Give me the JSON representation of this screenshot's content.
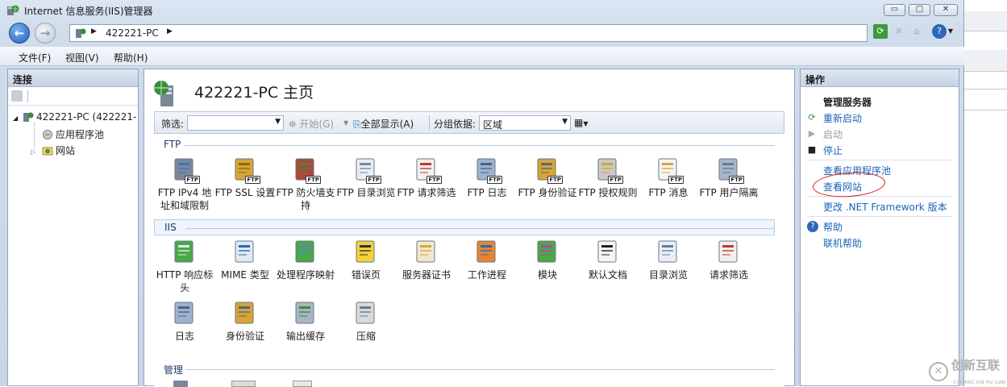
{
  "window": {
    "title": "Internet 信息服务(IIS)管理器",
    "controls": {
      "minimize": "▭",
      "maximize": "□",
      "close": "✕"
    }
  },
  "navbar": {
    "back_icon": "back-arrow-icon",
    "forward_icon": "forward-arrow-icon",
    "address": {
      "crumbs": [
        "422221-PC"
      ]
    },
    "toolbar_icons": [
      "refresh-icon",
      "stop-icon",
      "home-icon",
      "help-icon"
    ]
  },
  "menu": {
    "items": [
      "文件(F)",
      "视图(V)",
      "帮助(H)"
    ]
  },
  "connections": {
    "header": "连接",
    "tree": [
      {
        "label": "422221-PC (422221-",
        "level": 0,
        "expanded": true,
        "icon": "server-icon"
      },
      {
        "label": "应用程序池",
        "level": 1,
        "icon": "app-pool-icon"
      },
      {
        "label": "网站",
        "level": 1,
        "expanded": false,
        "icon": "sites-icon"
      }
    ]
  },
  "main": {
    "title": "422221-PC 主页",
    "filter": {
      "label": "筛选:",
      "value": "",
      "start": "开始(G)",
      "show_all": "全部显示(A)",
      "group_by_label": "分组依据:",
      "group_by_value": "区域"
    },
    "groups": [
      {
        "name": "FTP",
        "items": [
          {
            "label": "FTP IPv4 地址和域限制",
            "icon": "ftp-ip-restrictions-icon"
          },
          {
            "label": "FTP SSL 设置",
            "icon": "ftp-ssl-icon"
          },
          {
            "label": "FTP 防火墙支持",
            "icon": "ftp-firewall-icon"
          },
          {
            "label": "FTP 目录浏览",
            "icon": "ftp-directory-browsing-icon"
          },
          {
            "label": "FTP 请求筛选",
            "icon": "ftp-request-filtering-icon"
          },
          {
            "label": "FTP 日志",
            "icon": "ftp-logging-icon"
          },
          {
            "label": "FTP 身份验证",
            "icon": "ftp-authentication-icon"
          },
          {
            "label": "FTP 授权规则",
            "icon": "ftp-authorization-icon"
          },
          {
            "label": "FTP 消息",
            "icon": "ftp-messages-icon"
          },
          {
            "label": "FTP 用户隔离",
            "icon": "ftp-user-isolation-icon"
          }
        ]
      },
      {
        "name": "IIS",
        "items": [
          {
            "label": "HTTP 响应标头",
            "icon": "http-response-headers-icon"
          },
          {
            "label": "MIME 类型",
            "icon": "mime-types-icon"
          },
          {
            "label": "处理程序映射",
            "icon": "handler-mappings-icon"
          },
          {
            "label": "错误页",
            "icon": "error-pages-icon"
          },
          {
            "label": "服务器证书",
            "icon": "server-certificates-icon"
          },
          {
            "label": "工作进程",
            "icon": "worker-processes-icon"
          },
          {
            "label": "模块",
            "icon": "modules-icon"
          },
          {
            "label": "默认文档",
            "icon": "default-document-icon"
          },
          {
            "label": "目录浏览",
            "icon": "directory-browsing-icon"
          },
          {
            "label": "请求筛选",
            "icon": "request-filtering-icon"
          },
          {
            "label": "日志",
            "icon": "logging-icon"
          },
          {
            "label": "身份验证",
            "icon": "authentication-icon"
          },
          {
            "label": "输出缓存",
            "icon": "output-caching-icon"
          },
          {
            "label": "压缩",
            "icon": "compression-icon"
          }
        ]
      },
      {
        "name": "管理",
        "items": []
      }
    ]
  },
  "actions": {
    "header": "操作",
    "section_title": "管理服务器",
    "server": [
      {
        "label": "重新启动",
        "state": "link",
        "icon": "restart-icon"
      },
      {
        "label": "启动",
        "state": "disabled",
        "icon": "start-icon"
      },
      {
        "label": "停止",
        "state": "link",
        "icon": "stop-square-icon"
      }
    ],
    "views": [
      {
        "label": "查看应用程序池",
        "state": "link"
      },
      {
        "label": "查看网站",
        "state": "link",
        "highlighted": true
      }
    ],
    "framework": {
      "label": "更改 .NET Framework 版本",
      "state": "link"
    },
    "help": [
      {
        "label": "帮助",
        "state": "link",
        "icon": "help-icon"
      },
      {
        "label": "联机帮助",
        "state": "link"
      }
    ]
  },
  "watermark": {
    "text": "创新互联",
    "sub": "CHUANG XIN HU LIAN"
  },
  "colors": {
    "link": "#1b64b8",
    "annotation": "#d81c1c"
  }
}
